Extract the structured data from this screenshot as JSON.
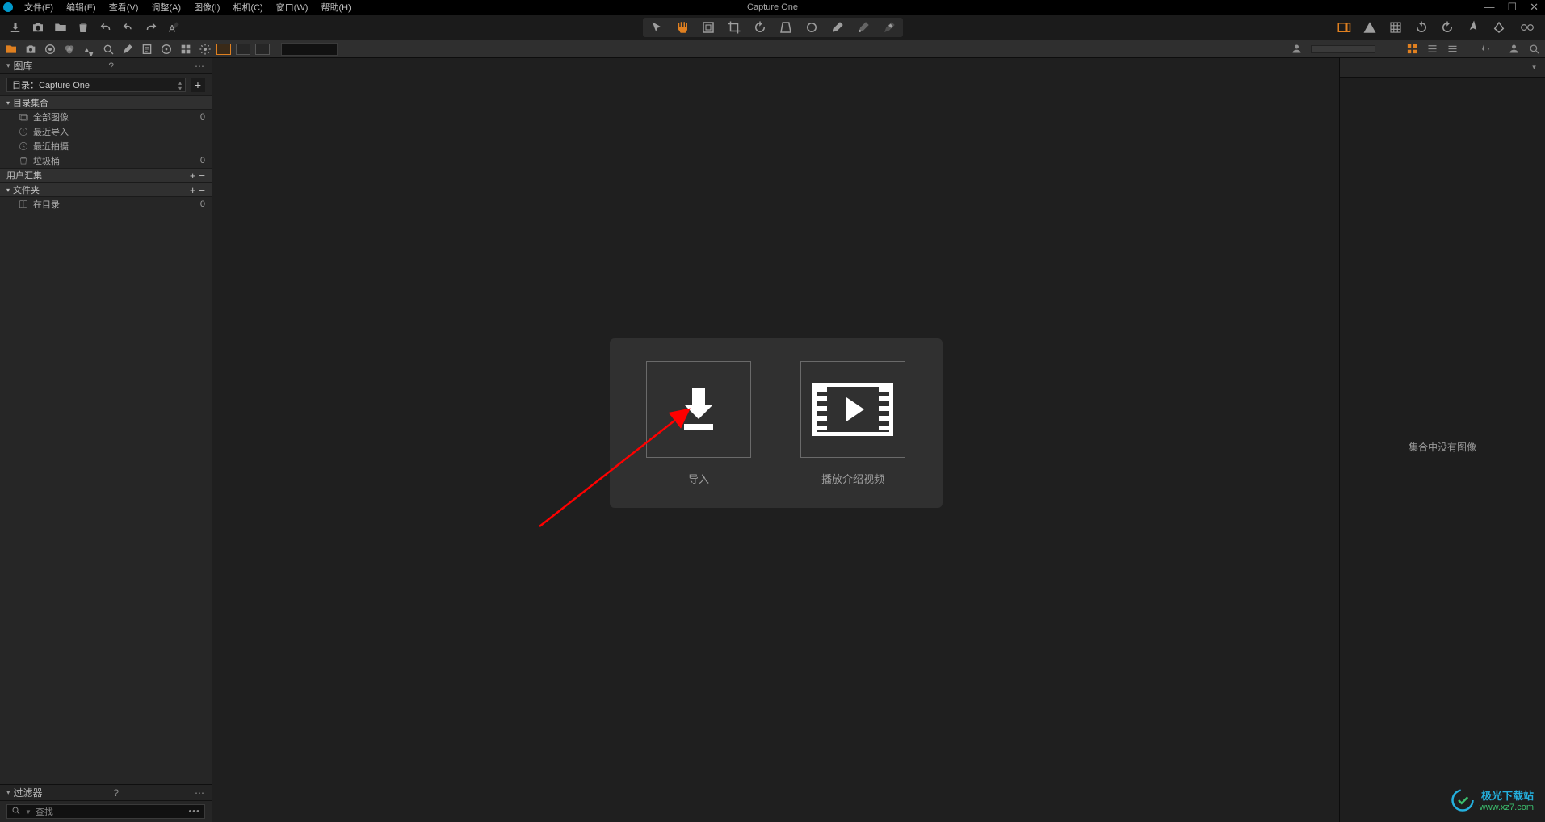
{
  "app_title": "Capture One",
  "menu": {
    "file": "文件(F)",
    "edit": "编辑(E)",
    "view": "查看(V)",
    "adjust": "调整(A)",
    "image": "图像(I)",
    "camera": "相机(C)",
    "window": "窗口(W)",
    "help": "帮助(H)"
  },
  "window_controls": {
    "min": "—",
    "max": "☐",
    "close": "✕"
  },
  "library_panel": {
    "title": "图库",
    "catalog_label": "目录：Capture One",
    "section_collections": "目录集合",
    "items": {
      "all_images": {
        "label": "全部图像",
        "count": "0"
      },
      "recent_import": {
        "label": "最近导入",
        "count": ""
      },
      "recent_capture": {
        "label": "最近拍摄",
        "count": ""
      },
      "trash": {
        "label": "垃圾桶",
        "count": "0"
      }
    },
    "section_user": "用户汇集",
    "section_folders": "文件夹",
    "folder_in_catalog": {
      "label": "在目录",
      "count": "0"
    }
  },
  "filters_panel": {
    "title": "过滤器",
    "search_placeholder": "查找"
  },
  "welcome": {
    "import_label": "导入",
    "video_label": "播放介绍视频"
  },
  "right_panel": {
    "empty_message": "集合中没有图像"
  },
  "watermark": {
    "line1": "极光下载站",
    "line2": "www.xz7.com"
  },
  "colors": {
    "accent": "#e08020",
    "bg_dark": "#1e1e1e"
  }
}
